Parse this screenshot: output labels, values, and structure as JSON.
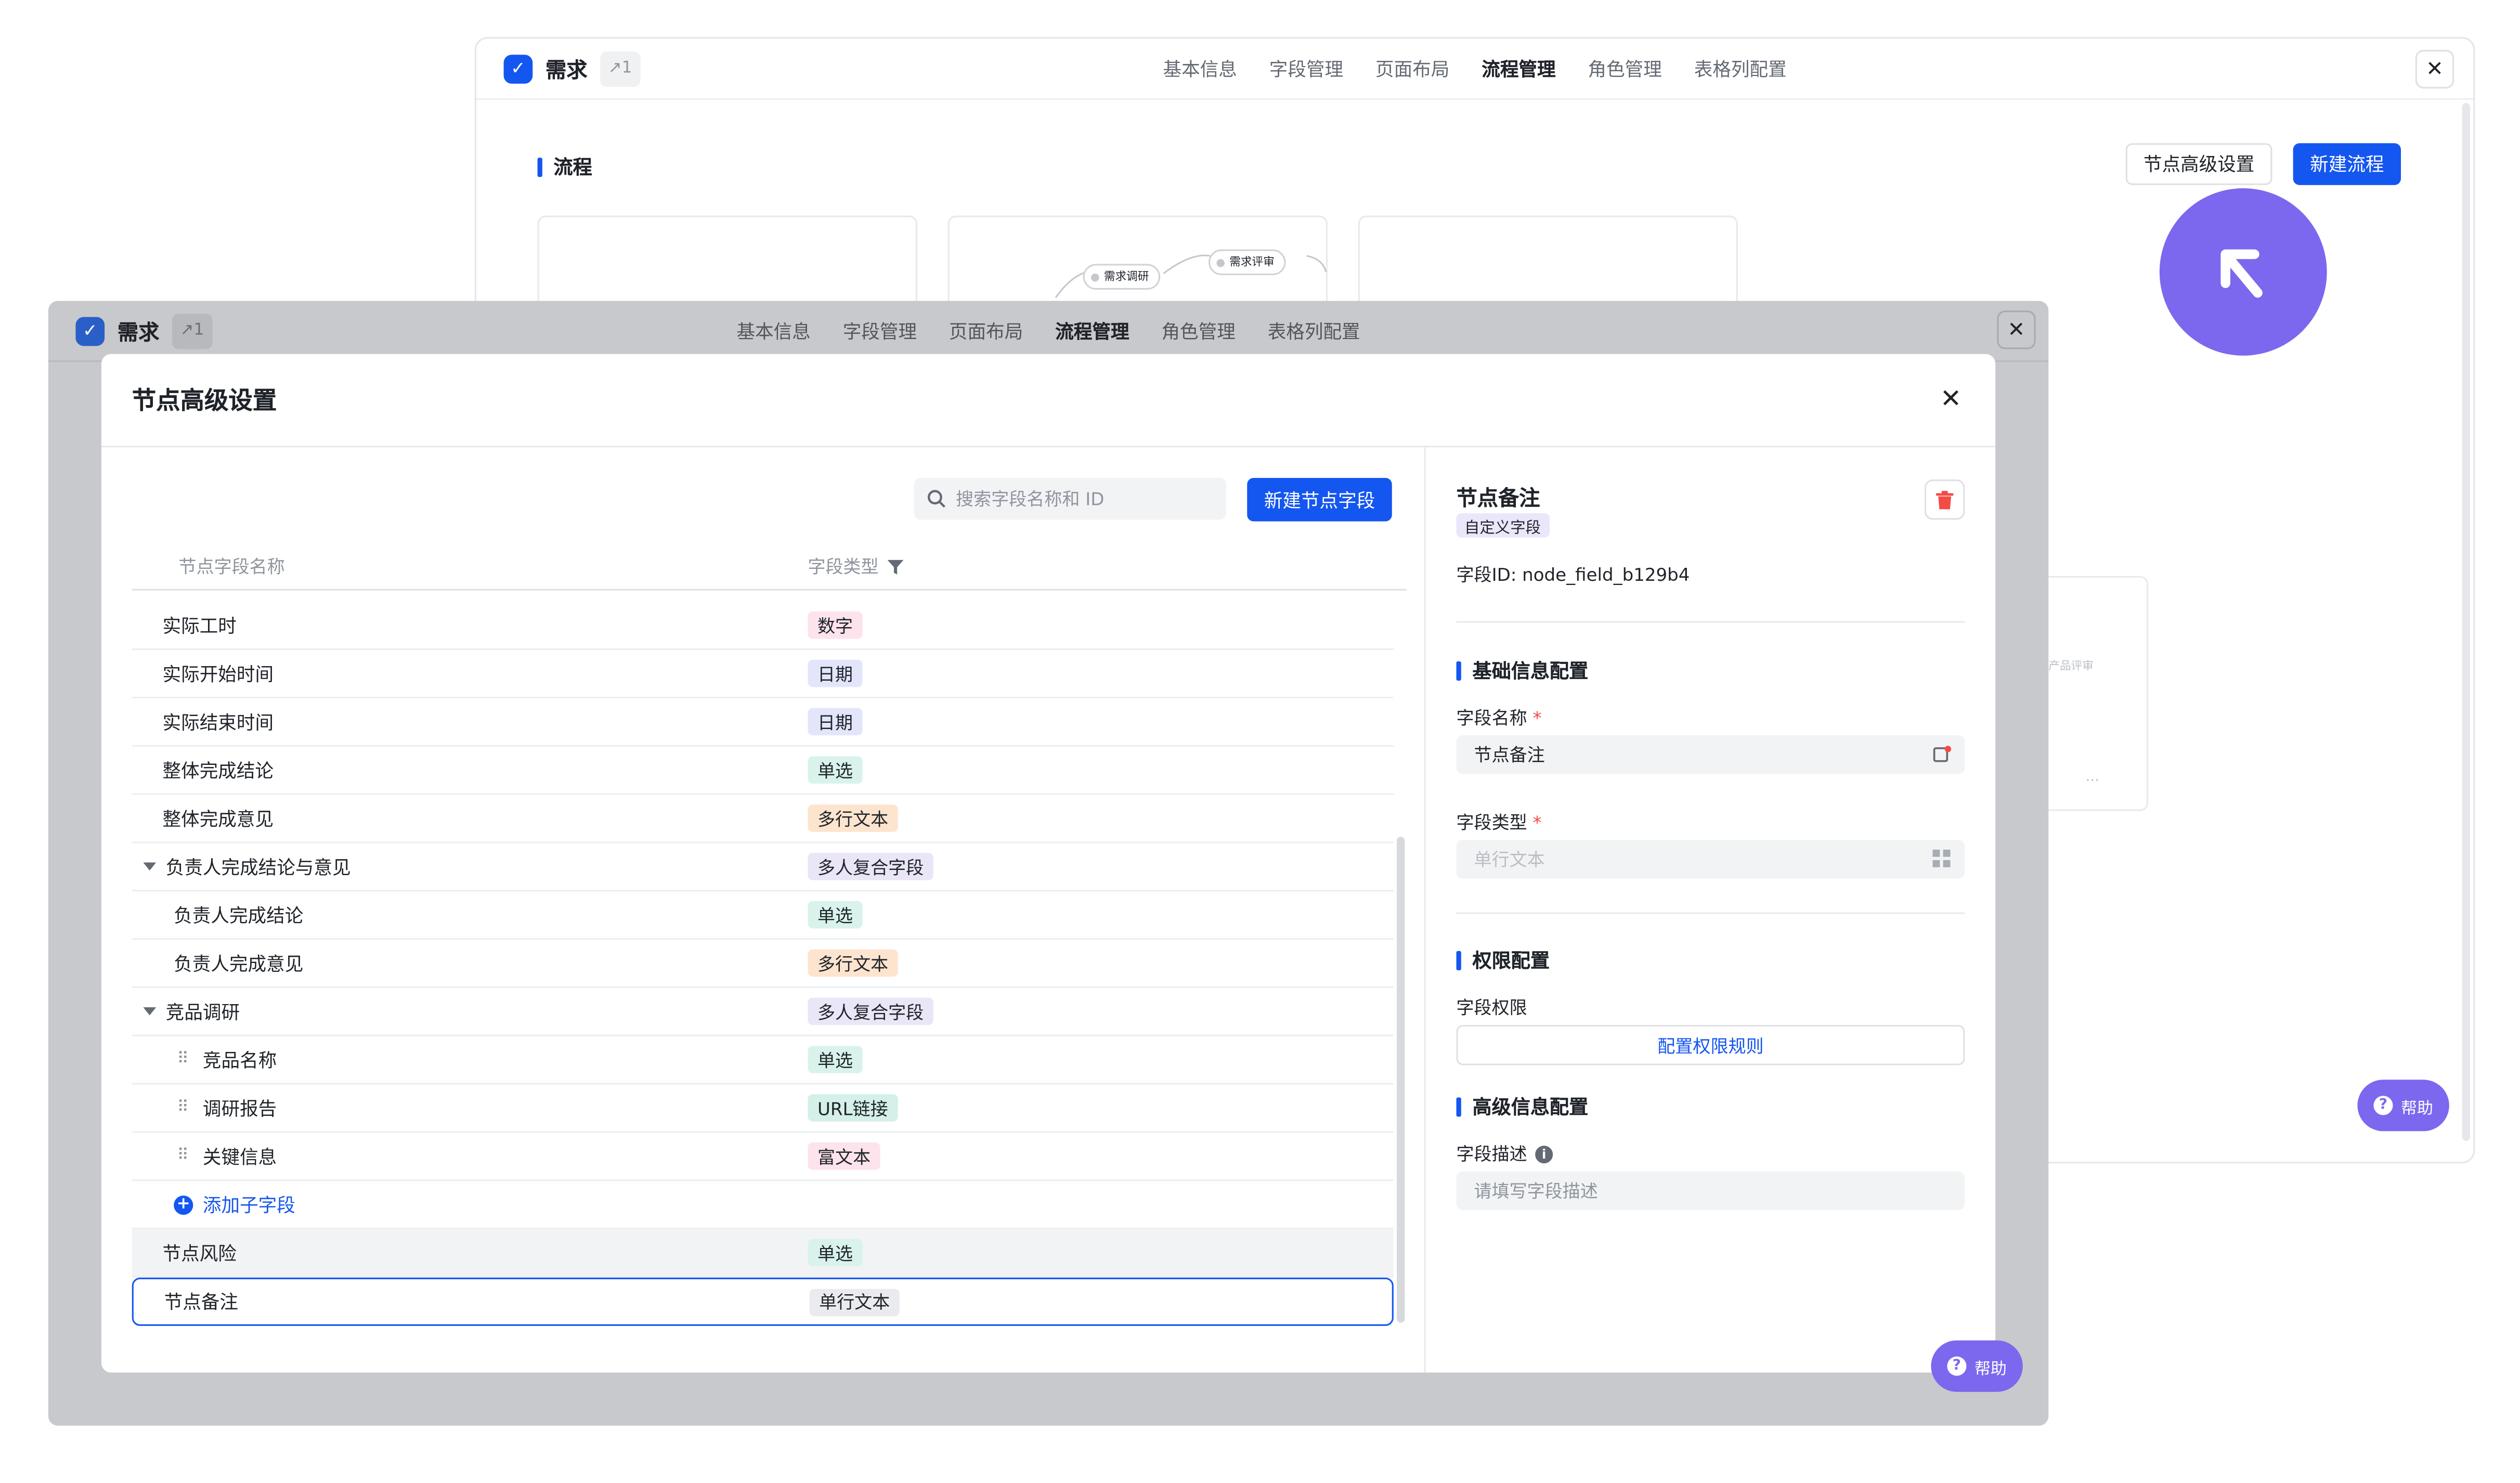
{
  "back_window": {
    "app_name": "需求",
    "version": "1",
    "tabs": [
      "基本信息",
      "字段管理",
      "页面布局",
      "流程管理",
      "角色管理",
      "表格列配置"
    ],
    "active_tab": "流程管理",
    "section_title": "流程",
    "btn_advanced": "节点高级设置",
    "btn_new_flow": "新建流程",
    "flow_nodes": [
      "需求调研",
      "需求评审"
    ],
    "faded_node": "产品评审",
    "ellipsis": "···",
    "help": "帮助"
  },
  "mid_window": {
    "app_name": "需求",
    "version": "1",
    "tabs": [
      "基本信息",
      "字段管理",
      "页面布局",
      "流程管理",
      "角色管理",
      "表格列配置"
    ],
    "active_tab": "流程管理"
  },
  "modal": {
    "title": "节点高级设置",
    "search_placeholder": "搜索字段名称和 ID",
    "btn_new_field": "新建节点字段",
    "col_name": "节点字段名称",
    "col_type": "字段类型",
    "rows": [
      {
        "name": "实际工时",
        "type": "数字",
        "kind": "number"
      },
      {
        "name": "实际开始时间",
        "type": "日期",
        "kind": "date"
      },
      {
        "name": "实际结束时间",
        "type": "日期",
        "kind": "date"
      },
      {
        "name": "整体完成结论",
        "type": "单选",
        "kind": "single"
      },
      {
        "name": "整体完成意见",
        "type": "多行文本",
        "kind": "multi"
      },
      {
        "name": "负责人完成结论与意见",
        "type": "多人复合字段",
        "kind": "composite",
        "group": true
      },
      {
        "name": "负责人完成结论",
        "type": "单选",
        "kind": "single",
        "level": 1
      },
      {
        "name": "负责人完成意见",
        "type": "多行文本",
        "kind": "multi",
        "level": 1
      },
      {
        "name": "竞品调研",
        "type": "多人复合字段",
        "kind": "composite",
        "group": true
      },
      {
        "name": "竞品名称",
        "type": "单选",
        "kind": "single",
        "level": 2
      },
      {
        "name": "调研报告",
        "type": "URL链接",
        "kind": "url",
        "level": 2
      },
      {
        "name": "关键信息",
        "type": "富文本",
        "kind": "rich",
        "level": 2
      },
      {
        "name": "添加子字段",
        "type": "",
        "kind": "add",
        "level": 1
      },
      {
        "name": "节点风险",
        "type": "单选",
        "kind": "single",
        "highlight": true
      },
      {
        "name": "节点备注",
        "type": "单行文本",
        "kind": "text",
        "selected": true
      }
    ],
    "detail": {
      "title": "节点备注",
      "badge": "自定义字段",
      "field_id_label": "字段ID:",
      "field_id": "node_field_b129b4",
      "basic_section": "基础信息配置",
      "name_label": "字段名称",
      "name_value": "节点备注",
      "type_label": "字段类型",
      "type_value": "单行文本",
      "perm_section": "权限配置",
      "perm_label": "字段权限",
      "perm_button": "配置权限规则",
      "adv_section": "高级信息配置",
      "desc_label": "字段描述",
      "desc_placeholder": "请填写字段描述",
      "required_mark": "*"
    },
    "help": "帮助"
  },
  "colors": {
    "accent": "#1456f0",
    "help": "#7b68ee",
    "tag_number": [
      "#fde3ec",
      "#1f2329"
    ],
    "tag_date": [
      "#e3e6fb",
      "#1f2329"
    ],
    "tag_single": [
      "#d9f3ec",
      "#1f2329"
    ],
    "tag_multi": [
      "#fde4cf",
      "#1f2329"
    ],
    "tag_composite": [
      "#eae6f8",
      "#1f2329"
    ],
    "tag_url": [
      "#d4f0e8",
      "#1f2329"
    ],
    "tag_rich": [
      "#fde3ec",
      "#1f2329"
    ],
    "tag_text": [
      "#eaebef",
      "#1f2329"
    ]
  }
}
